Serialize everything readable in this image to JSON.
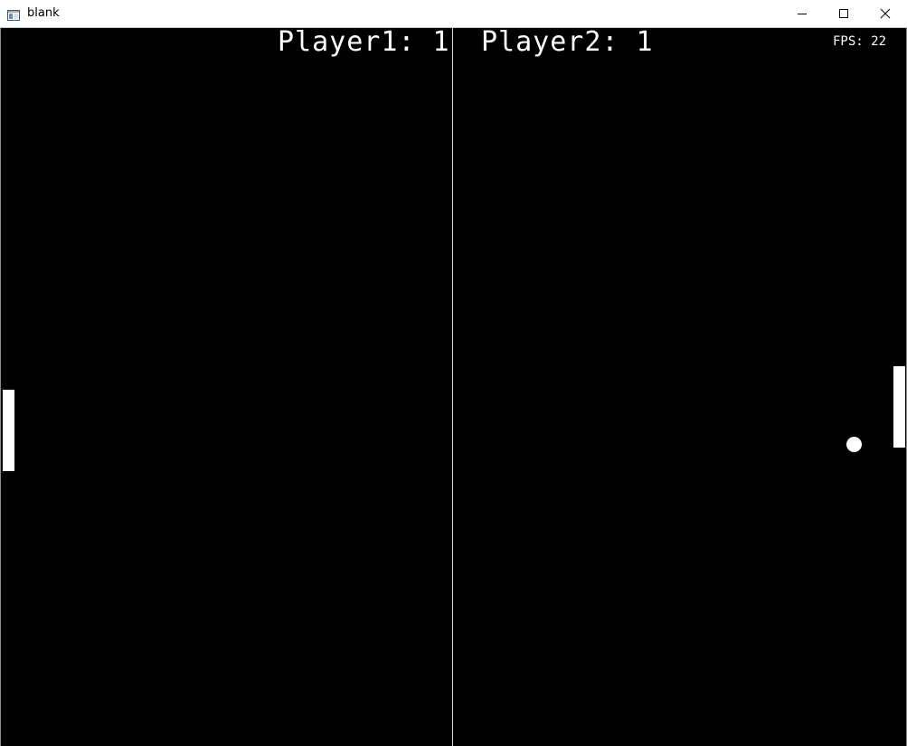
{
  "window": {
    "title": "blank",
    "icon": "app-window-icon",
    "controls": {
      "minimize_icon": "minimize-icon",
      "maximize_icon": "maximize-icon",
      "close_icon": "close-icon"
    }
  },
  "game": {
    "background_color": "#000000",
    "foreground_color": "#ffffff",
    "player1_score_text": "Player1: 1",
    "player2_score_text": "Player2: 1",
    "fps_text": "FPS: 22"
  }
}
